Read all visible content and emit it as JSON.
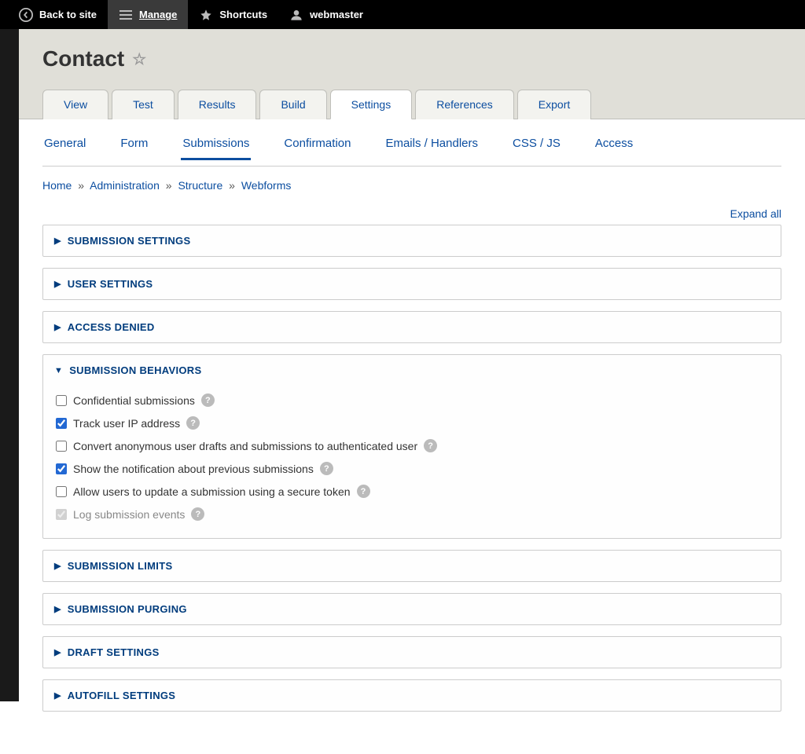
{
  "toolbar": {
    "back": "Back to site",
    "manage": "Manage",
    "shortcuts": "Shortcuts",
    "user": "webmaster"
  },
  "page": {
    "title": "Contact"
  },
  "primary_tabs": [
    {
      "label": "View",
      "active": false
    },
    {
      "label": "Test",
      "active": false
    },
    {
      "label": "Results",
      "active": false
    },
    {
      "label": "Build",
      "active": false
    },
    {
      "label": "Settings",
      "active": true
    },
    {
      "label": "References",
      "active": false
    },
    {
      "label": "Export",
      "active": false
    }
  ],
  "secondary_tabs": [
    {
      "label": "General",
      "active": false
    },
    {
      "label": "Form",
      "active": false
    },
    {
      "label": "Submissions",
      "active": true
    },
    {
      "label": "Confirmation",
      "active": false
    },
    {
      "label": "Emails / Handlers",
      "active": false
    },
    {
      "label": "CSS / JS",
      "active": false
    },
    {
      "label": "Access",
      "active": false
    }
  ],
  "breadcrumb": {
    "items": [
      "Home",
      "Administration",
      "Structure",
      "Webforms"
    ],
    "sep": "»"
  },
  "actions": {
    "expand_all": "Expand all"
  },
  "panels": {
    "submission_settings": "Submission Settings",
    "user_settings": "User Settings",
    "access_denied": "Access Denied",
    "submission_behaviors": "Submission Behaviors",
    "submission_limits": "Submission Limits",
    "submission_purging": "Submission Purging",
    "draft_settings": "Draft Settings",
    "autofill_settings": "Autofill Settings"
  },
  "behaviors": {
    "confidential": {
      "label": "Confidential submissions",
      "checked": false,
      "disabled": false
    },
    "track_ip": {
      "label": "Track user IP address",
      "checked": true,
      "disabled": false
    },
    "convert_anon": {
      "label": "Convert anonymous user drafts and submissions to authenticated user",
      "checked": false,
      "disabled": false
    },
    "show_notification": {
      "label": "Show the notification about previous submissions",
      "checked": true,
      "disabled": false
    },
    "allow_token": {
      "label": "Allow users to update a submission using a secure token",
      "checked": false,
      "disabled": false
    },
    "log_events": {
      "label": "Log submission events",
      "checked": true,
      "disabled": true
    }
  }
}
